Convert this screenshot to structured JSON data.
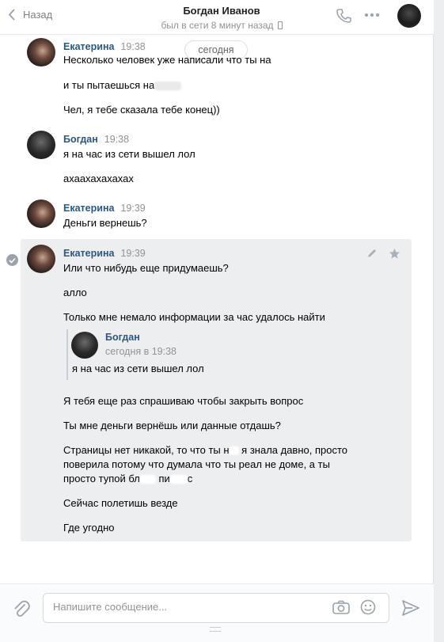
{
  "header": {
    "back_label": "Назад",
    "contact_name": "Богдан Иванов",
    "status": "был в сети 8 минут назад"
  },
  "day_separator": "сегодня",
  "messages": [
    {
      "author": "Екатерина",
      "time": "19:38",
      "lines": [
        "Несколько человек уже написали что ты на",
        "и ты пытаешься на",
        "Чел, я тебе сказала тебе конец))"
      ]
    },
    {
      "author": "Богдан",
      "time": "19:38",
      "lines": [
        "я на час из сети вышел лол",
        "ахаахахахахах"
      ]
    },
    {
      "author": "Екатерина",
      "time": "19:39",
      "lines": [
        "Деньги вернешь?"
      ]
    },
    {
      "author": "Екатерина",
      "time": "19:39",
      "selected": true,
      "lines": [
        "Или что нибудь еще придумаешь?",
        "алло",
        "Только мне немало информации за час удалось найти",
        "Я тебя еще раз спрашиваю чтобы закрыть вопрос",
        "Ты мне деньги вернёшь или данные отдашь?",
        "Страницы нет никакой, то что ты н",
        "я знала давно, просто",
        "поверила потому что думала что ты реал не доме, а ты",
        "просто тупой бл",
        "пи",
        "с",
        "Сейчас полетишь везде",
        "Где угодно"
      ],
      "forwarded": {
        "author": "Богдан",
        "date": "сегодня в 19:38",
        "text": "я на час из сети вышел лол"
      }
    }
  ],
  "composer": {
    "placeholder": "Напишите сообщение..."
  },
  "colors": {
    "link": "#2a5885",
    "selected_bg": "#edeef0",
    "muted": "#939393"
  }
}
